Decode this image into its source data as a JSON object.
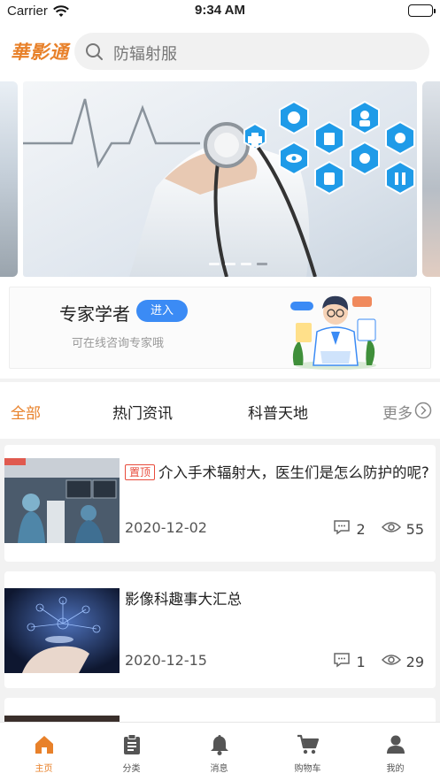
{
  "status_bar": {
    "carrier": "Carrier",
    "time": "9:34 AM"
  },
  "header": {
    "logo": "華影通",
    "search_placeholder": "防辐射服"
  },
  "banner": {
    "page_count": 4,
    "active_index": 3
  },
  "expert": {
    "title": "专家学者",
    "enter_label": "进入",
    "subtitle": "可在线咨询专家哦"
  },
  "tabs": [
    {
      "label": "全部",
      "active": true
    },
    {
      "label": "热门资讯",
      "active": false
    },
    {
      "label": "科普天地",
      "active": false
    }
  ],
  "tabs_more": "更多",
  "news": [
    {
      "pinned": true,
      "pin_label": "置顶",
      "title": "介入手术辐射大，医生们是怎么防护的呢?",
      "date": "2020-12-02",
      "comments": "2",
      "views": "55"
    },
    {
      "pinned": false,
      "title": "影像科趣事大汇总",
      "date": "2020-12-15",
      "comments": "1",
      "views": "29"
    }
  ],
  "tabbar": [
    {
      "label": "主页",
      "icon": "home-icon",
      "active": true
    },
    {
      "label": "分类",
      "icon": "clipboard-icon",
      "active": false
    },
    {
      "label": "消息",
      "icon": "bell-icon",
      "active": false
    },
    {
      "label": "购物车",
      "icon": "cart-icon",
      "active": false
    },
    {
      "label": "我的",
      "icon": "person-icon",
      "active": false
    }
  ],
  "colors": {
    "accent": "#e8812a",
    "button_blue": "#3b8bf5",
    "pin_red": "#e84b3c"
  }
}
